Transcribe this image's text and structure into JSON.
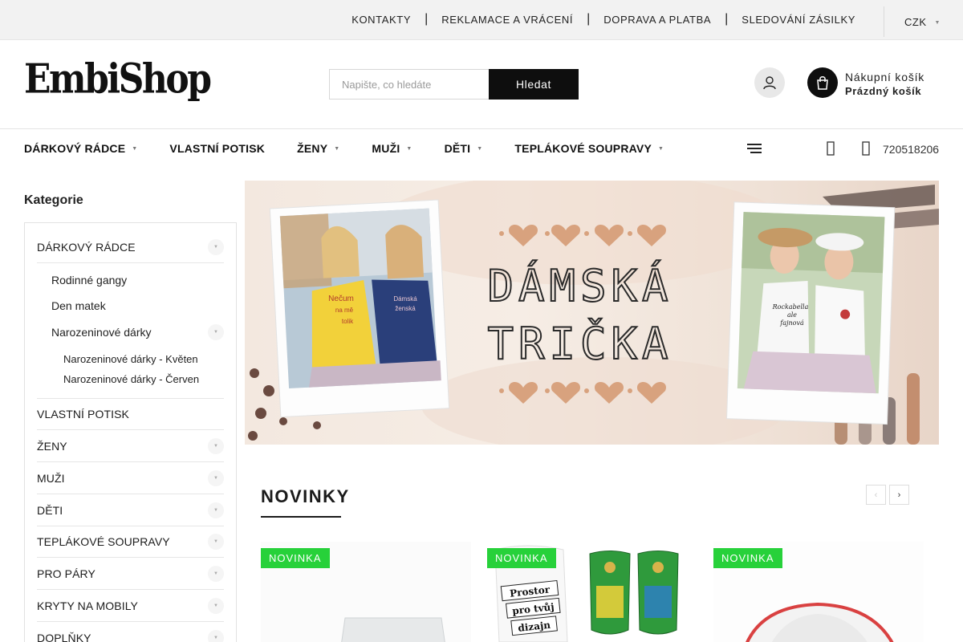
{
  "topbar": {
    "links": [
      "KONTAKTY",
      "REKLAMACE A VRÁCENÍ",
      "DOPRAVA A PLATBA",
      "SLEDOVÁNÍ ZÁSILKY"
    ],
    "separator": "|",
    "currency": "CZK"
  },
  "header": {
    "logo": "EmbiShop",
    "search_placeholder": "Napište, co hledáte",
    "search_button": "Hledat",
    "cart_title": "Nákupní košík",
    "cart_status": "Prázdný košík"
  },
  "nav": {
    "items": [
      {
        "label": "DÁRKOVÝ RÁDCE",
        "has_submenu": true
      },
      {
        "label": "VLASTNÍ POTISK",
        "has_submenu": false
      },
      {
        "label": "ŽENY",
        "has_submenu": true
      },
      {
        "label": "MUŽI",
        "has_submenu": true
      },
      {
        "label": "DĚTI",
        "has_submenu": true
      },
      {
        "label": "TEPLÁKOVÉ SOUPRAVY",
        "has_submenu": true
      }
    ],
    "phone": "720518206"
  },
  "sidebar": {
    "title": "Kategorie",
    "top_first": "DÁRKOVÝ RÁDCE",
    "sub_items": [
      "Rodinné gangy",
      "Den matek",
      "Narozeninové dárky"
    ],
    "sub_sub_items": [
      "Narozeninové dárky - Květen",
      "Narozeninové dárky - Červen"
    ],
    "categories": [
      "VLASTNÍ POTISK",
      "ŽENY",
      "MUŽI",
      "DĚTI",
      "TEPLÁKOVÉ SOUPRAVY",
      "PRO PÁRY",
      "KRYTY NA MOBILY",
      "DOPLŇKY"
    ]
  },
  "banner": {
    "line1": "DÁMSKÁ",
    "line2": "TRIČKA",
    "tshirt_left_1": "Nečum",
    "tshirt_left_2": "na mě",
    "tshirt_left_3": "tolik",
    "tshirt_right_1": "Dámská",
    "tshirt_right_2": "ženská",
    "tshirt_right_3": "Rockabella",
    "tshirt_right_4": "ale",
    "tshirt_right_5": "fajnová"
  },
  "novinky": {
    "title": "NOVINKY",
    "badge": "NOVINKA",
    "product2_text_1": "Prostor",
    "product2_text_2": "pro tvůj",
    "product2_text_3": "dizajn"
  },
  "colors": {
    "accent": "#27d13a",
    "dark": "#0e0e0e",
    "banner_heart": "#d8a27e"
  }
}
